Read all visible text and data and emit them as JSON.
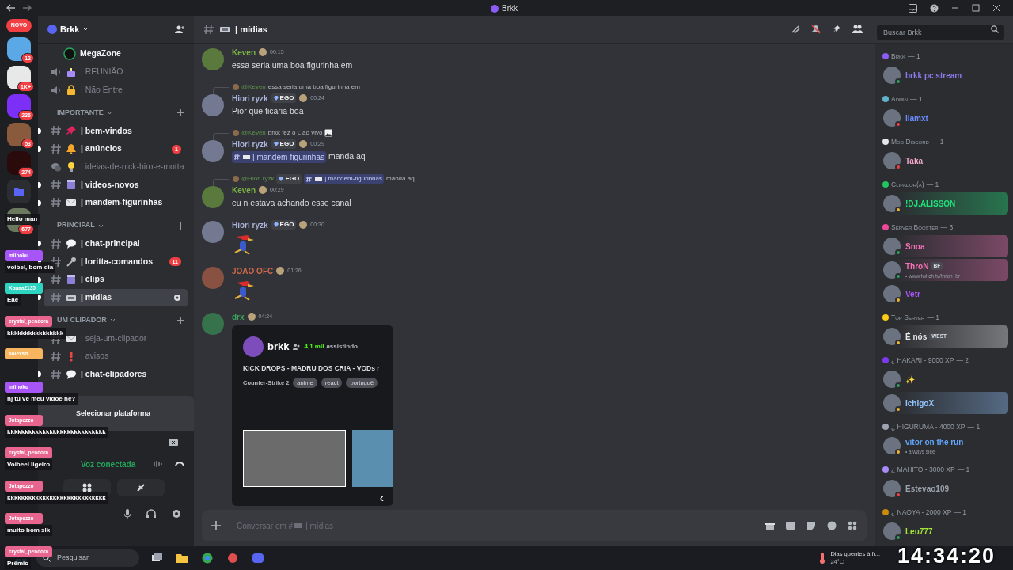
{
  "window": {
    "title": "Brkk"
  },
  "server_rail": [
    {
      "kind": "pill",
      "badge": "NOVO"
    },
    {
      "kind": "server",
      "color": "#5aa9e6",
      "badge": "12"
    },
    {
      "kind": "server",
      "color": "#e8e8e8",
      "badge": "1K+"
    },
    {
      "kind": "server",
      "color": "#7b2ff7",
      "badge": "236"
    },
    {
      "kind": "server",
      "color": "#8a5a3c",
      "badge": "53"
    },
    {
      "kind": "server",
      "color": "#2a0a0a",
      "badge": "274"
    },
    {
      "kind": "folder",
      "color": "#5865f2"
    },
    {
      "kind": "server",
      "color": "#6b7a5e",
      "badge": "677"
    }
  ],
  "server": {
    "name": "Brkk"
  },
  "channels": [
    {
      "kind": "member",
      "name": "MegaZone"
    },
    {
      "kind": "stage",
      "name": "| REUNIÃO",
      "unread": false
    },
    {
      "kind": "stage",
      "name": "| Não Entre",
      "unread": false
    },
    {
      "kind": "category",
      "name": "IMPORTANTE"
    },
    {
      "kind": "text",
      "name": "| bem-vindos",
      "unread": true,
      "selected": false
    },
    {
      "kind": "text",
      "name": "| anúncios",
      "unread": true,
      "selected": false,
      "badge": "1"
    },
    {
      "kind": "forum",
      "name": "| ideias-de-nick-hiro-e-motta",
      "unread": false,
      "selected": false
    },
    {
      "kind": "text",
      "name": "| videos-novos",
      "unread": true,
      "selected": false
    },
    {
      "kind": "text",
      "name": "| mandem-figurinhas",
      "unread": true,
      "selected": false
    },
    {
      "kind": "category",
      "name": "PRINCIPAL"
    },
    {
      "kind": "text",
      "name": "| chat-principal",
      "unread": true,
      "selected": false
    },
    {
      "kind": "text",
      "name": "| loritta-comandos",
      "unread": true,
      "selected": false,
      "badge": "11"
    },
    {
      "kind": "text",
      "name": "| clips",
      "unread": true,
      "selected": false
    },
    {
      "kind": "text",
      "name": "| mídias",
      "unread": true,
      "selected": true
    },
    {
      "kind": "category",
      "name": "UM CLIPADOR"
    },
    {
      "kind": "text",
      "name": "| seja-um-clipador",
      "unread": false,
      "selected": false
    },
    {
      "kind": "text",
      "name": "| avisos",
      "unread": false,
      "selected": false
    },
    {
      "kind": "text",
      "name": "| chat-clipadores",
      "unread": true,
      "selected": false
    }
  ],
  "quest": {
    "title": "Selecionar plataforma"
  },
  "voice": {
    "status": "Voz conectada"
  },
  "channel_header": {
    "name": "| mídias"
  },
  "search": {
    "placeholder": "Buscar Brkk"
  },
  "messages": [
    {
      "author": "Keven",
      "color": "#7cb342",
      "time": "00:15",
      "kind": "text",
      "text": "essa seria uma boa figurinha em"
    },
    {
      "author": "Hiori ryzk",
      "color": "#aab3d9",
      "tag": "EGO",
      "time": "00:24",
      "reply": {
        "mention": "@Keven",
        "text": "essa seria uma boa figurinha em"
      },
      "kind": "text",
      "text": "Pior que ficaria boa"
    },
    {
      "author": "Hiori ryzk",
      "color": "#aab3d9",
      "tag": "EGO",
      "time": "00:29",
      "reply": {
        "mention": "@Keven",
        "text": "brkk fez o L ao vivo",
        "image": true
      },
      "kind": "mention",
      "channel": "| mandem-figurinhas",
      "text": "manda aq"
    },
    {
      "author": "Keven",
      "color": "#7cb342",
      "time": "00:29",
      "reply": {
        "mention": "@Hiori ryzk",
        "tag": "EGO",
        "channel": "| mandem-figurinhas",
        "text": "manda aq"
      },
      "kind": "text",
      "text": "eu n estava achando esse canal"
    },
    {
      "author": "Hiori ryzk",
      "color": "#aab3d9",
      "tag": "EGO",
      "time": "00:30",
      "kind": "sticker"
    },
    {
      "author": "JOAO OFC",
      "color": "#d0694a",
      "time": "01:26",
      "kind": "sticker"
    },
    {
      "author": "drx",
      "color": "#3ba55d",
      "time": "04:24",
      "kind": "embed",
      "embed": {
        "streamer": "brkk",
        "viewers": "4,1 mil",
        "viewers_label": "assistindo",
        "title": "KICK DROPS - MADRU DOS CRIA - VODs r",
        "game": "Counter-Strike 2",
        "tags": [
          "anime",
          "react",
          "portuguê"
        ],
        "nav": "‹"
      }
    }
  ],
  "composer": {
    "placeholder": "Conversar em #",
    "placeholder_channel": "| mídias"
  },
  "member_groups": [
    {
      "name": "Brkk",
      "count": "— 1",
      "color": "#8b5cf6",
      "members": [
        {
          "name": "brkk pc stream",
          "color": "#8c7cf0",
          "kind": "online"
        }
      ]
    },
    {
      "name": "Admin",
      "count": "— 1",
      "color": "#5fb3c9",
      "members": [
        {
          "name": "liamxt",
          "color": "#6b8cff",
          "kind": "dnd"
        }
      ]
    },
    {
      "name": "Mod Discord",
      "count": "— 1",
      "color": "#e5e7eb",
      "members": [
        {
          "name": "Taka",
          "color": "#f0a6c8",
          "kind": "dnd"
        }
      ]
    },
    {
      "name": "Clipador(a)",
      "count": "— 1",
      "color": "#22c55e",
      "members": [
        {
          "name": "!DJ.ALISSON",
          "color": "#22e07a",
          "kind": "idle",
          "banner": true
        }
      ]
    },
    {
      "name": "Server Booster",
      "count": "— 3",
      "color": "#ec4899",
      "members": [
        {
          "name": "Snoa",
          "color": "#f472b6",
          "kind": "online",
          "banner": true
        },
        {
          "name": "ThroN",
          "color": "#f472b6",
          "kind": "online",
          "tag": "BF",
          "activity": "• www.twitch.tv/thron_br",
          "banner": true
        },
        {
          "name": "Vetr",
          "color": "#a855f7",
          "kind": "idle",
          "banner": false
        }
      ]
    },
    {
      "name": "Top Server",
      "count": "— 1",
      "color": "#facc15",
      "members": [
        {
          "name": "É nós",
          "color": "#e5e7eb",
          "kind": "idle",
          "tag": "WEST",
          "banner": true
        }
      ]
    },
    {
      "name": "¿ HAKARI - 9000 XP",
      "count": "— 2",
      "color": "#7c3aed",
      "members": [
        {
          "name": "✨",
          "kind": "online"
        },
        {
          "name": "IchigoX",
          "color": "#93c5fd",
          "kind": "idle",
          "banner": true
        }
      ]
    },
    {
      "name": "¿ HIGURUMA - 4000 XP",
      "count": "— 1",
      "color": "#9ca3af",
      "members": [
        {
          "name": "vitor on the run",
          "color": "#60a5fa",
          "kind": "idle",
          "activity": "• always slee"
        }
      ]
    },
    {
      "name": "¿ MAHITO - 3000 XP",
      "count": "— 1",
      "color": "#a78bfa",
      "members": [
        {
          "name": "Estevao109",
          "color": "#9ca3af",
          "kind": "dnd"
        }
      ]
    },
    {
      "name": "¿ NAOYA - 2000 XP",
      "count": "— 1",
      "color": "#ca8a04",
      "members": [
        {
          "name": "Leu777",
          "color": "#a3e635",
          "kind": "online"
        }
      ]
    }
  ],
  "chat_overlay": [
    {
      "text": "Hello man"
    },
    {
      "user": "miihoku",
      "color": "#a855f7",
      "text": "voibel, bom dia"
    },
    {
      "user": "Kauaa2135",
      "color": "#2dd4bf",
      "text": "Eae"
    },
    {
      "user": "crystal_pendora",
      "color": "#e8658f",
      "text": "kkkkkkkkkkkkkkkk"
    },
    {
      "user": "solexsd",
      "color": "#f6b55e"
    },
    {
      "user": "miihoku",
      "color": "#a855f7",
      "text": "hj tu ve meu vidoe ne?"
    },
    {
      "user": "Jotapezzo",
      "color": "#e8658f",
      "text": "kkkkkkkkkkkkkkkkkkkkkkkkkkkk"
    },
    {
      "user": "crystal_pendora",
      "color": "#e8658f",
      "text": "Voibeel ligeiro"
    },
    {
      "user": "Jotapezzo",
      "color": "#e8658f",
      "text": "kkkkkkkkkkkkkkkkkkkkkkkkkkkk"
    },
    {
      "user": "Jotapezzo",
      "color": "#e8658f",
      "text": "muito bom slk"
    },
    {
      "user": "crystal_pendora",
      "color": "#e8658f",
      "text": "Prêmio"
    }
  ],
  "taskbar": {
    "search": "Pesquisar",
    "weather": "Dias quentes à fr...",
    "temperature": "24°C"
  },
  "clock_overlay": "14:34:20"
}
